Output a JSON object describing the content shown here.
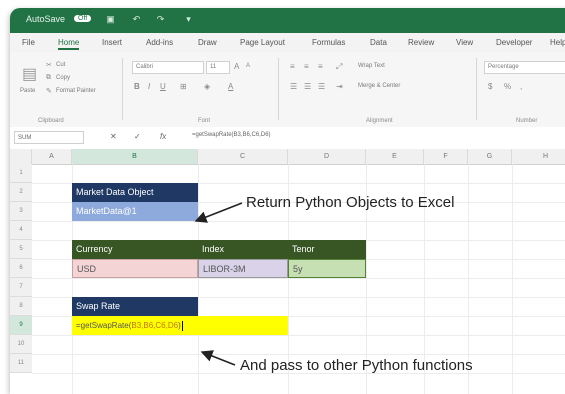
{
  "title_bar": {
    "autosave_label": "AutoSave",
    "toggle_state": "Off"
  },
  "menu_tabs": [
    "File",
    "Home",
    "Insert",
    "Add-ins",
    "Draw",
    "Page Layout",
    "Formulas",
    "Data",
    "Review",
    "View",
    "Developer",
    "Help"
  ],
  "active_tab": "Home",
  "ribbon": {
    "cut": "Cut",
    "copy": "Copy",
    "format_painter": "Format Painter",
    "paste": "Paste",
    "font_name": "Calibri",
    "font_size": "11",
    "wrap_text": "Wrap Text",
    "merge_center": "Merge & Center",
    "number_format": "Percentage",
    "groups": [
      "Clipboard",
      "Font",
      "Alignment",
      "Number"
    ]
  },
  "formula_bar": {
    "name_box": "SUM",
    "formula": "=getSwapRate(B3,B6,C6,D6)"
  },
  "columns": [
    "A",
    "B",
    "C",
    "D",
    "E",
    "F",
    "G",
    "H"
  ],
  "rows": [
    "1",
    "2",
    "3",
    "4",
    "5",
    "6",
    "7",
    "8",
    "9",
    "10",
    "11"
  ],
  "cells": {
    "b2": "Market Data Object",
    "b3": "MarketData@1",
    "b5": "Currency",
    "c5": "Index",
    "d5": "Tenor",
    "b6": "USD",
    "c6": "LIBOR-3M",
    "d6": "5y",
    "b8": "Swap Rate",
    "b9_prefix": "=getSwapRate(",
    "b9_refs": "B3,B6,C6,D6",
    "b9_suffix": ")"
  },
  "annotations": {
    "top": "Return Python Objects to Excel",
    "bottom": "And pass to other Python functions"
  },
  "colors": {
    "excel_green": "#217346",
    "navy": "#1f3864",
    "header_green": "#375623",
    "highlight_yellow": "#ffff00"
  }
}
